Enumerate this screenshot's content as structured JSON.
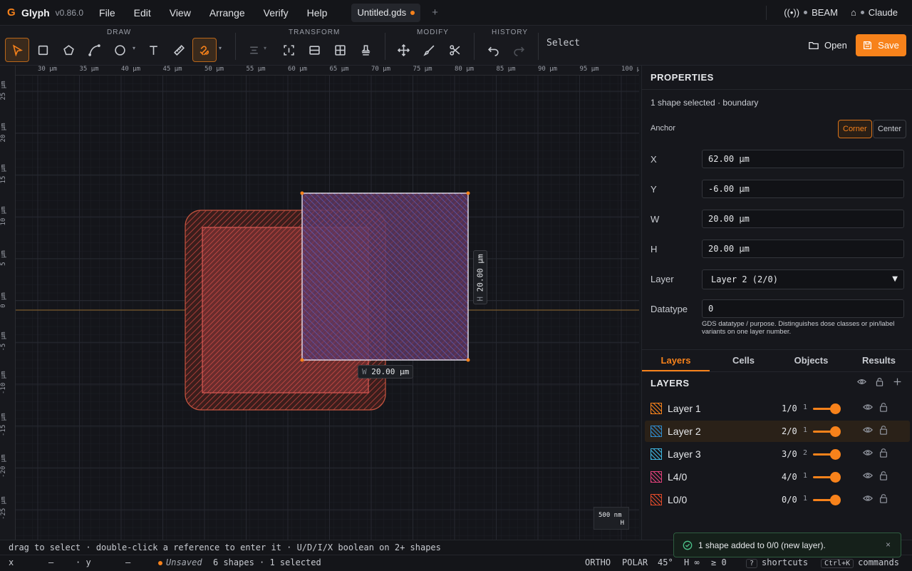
{
  "app": {
    "name": "Glyph",
    "version": "v0.86.0"
  },
  "menu": [
    "File",
    "Edit",
    "View",
    "Arrange",
    "Verify",
    "Help"
  ],
  "tab": {
    "title": "Untitled.gds",
    "add": "+"
  },
  "connections": {
    "beam": "BEAM",
    "claude": "Claude"
  },
  "toolbar": {
    "groups": {
      "draw": "DRAW",
      "transform": "TRANSFORM",
      "modify": "MODIFY",
      "history": "HISTORY"
    },
    "mode": "Select",
    "open": "Open",
    "save": "Save"
  },
  "rulers": {
    "x": [
      "30 µm",
      "35 µm",
      "40 µm",
      "45 µm",
      "50 µm",
      "55 µm",
      "60 µm",
      "65 µm",
      "70 µm",
      "75 µm",
      "80 µm",
      "85 µm",
      "90 µm",
      "95 µm",
      "100 µ"
    ],
    "y": [
      "25 µm",
      "20 µm",
      "15 µm",
      "10 µm",
      "5 µm",
      "0 µm",
      "-5 µm",
      "-10 µm",
      "-15 µm",
      "-20 µm",
      "-25 µm"
    ]
  },
  "canvas": {
    "width_label_prefix": "W",
    "width_label": "20.00 µm",
    "height_label_prefix": "H",
    "height_label": "20.00 µm",
    "scale": "500 nm",
    "scale_sub": "H"
  },
  "hint": "drag to select · double-click a reference to enter it · U/D/I/X boolean on 2+ shapes",
  "status": {
    "x_label": "x",
    "x_value": "—",
    "y_label": "· y",
    "y_value": "—",
    "unsaved": "Unsaved",
    "shapes": "6 shapes · 1 selected",
    "ortho": "ORTHO",
    "polar": "POLAR",
    "angle": "45°",
    "h": "H ∞",
    "ge": "≥ 0",
    "shortcuts_key": "?",
    "shortcuts": "shortcuts",
    "commands_key": "Ctrl+K",
    "commands": "commands"
  },
  "properties": {
    "title": "PROPERTIES",
    "selection": "1 shape selected · boundary",
    "anchor_label": "Anchor",
    "anchor_corner": "Corner",
    "anchor_center": "Center",
    "x_label": "X",
    "x": "62.00 µm",
    "y_label": "Y",
    "y": "-6.00 µm",
    "w_label": "W",
    "w": "20.00 µm",
    "h_label": "H",
    "h": "20.00 µm",
    "layer_label": "Layer",
    "layer": "Layer 2 (2/0)",
    "datatype_label": "Datatype",
    "datatype": "0",
    "datatype_help": "GDS datatype / purpose. Distinguishes dose classes or pin/label variants on one layer number."
  },
  "panel_tabs": [
    "Layers",
    "Cells",
    "Objects",
    "Results"
  ],
  "layers": {
    "title": "LAYERS",
    "items": [
      {
        "name": "Layer 1",
        "num": "1/0",
        "count": "1",
        "color": "#f7821b"
      },
      {
        "name": "Layer 2",
        "num": "2/0",
        "count": "1",
        "color": "#2f8ccf"
      },
      {
        "name": "Layer 3",
        "num": "3/0",
        "count": "2",
        "color": "#3fb6e0"
      },
      {
        "name": "L4/0",
        "num": "4/0",
        "count": "1",
        "color": "#e0407a"
      },
      {
        "name": "L0/0",
        "num": "0/0",
        "count": "1",
        "color": "#e04a2a"
      }
    ]
  },
  "toast": {
    "text": "1 shape added to 0/0 (new layer).",
    "close": "×"
  }
}
